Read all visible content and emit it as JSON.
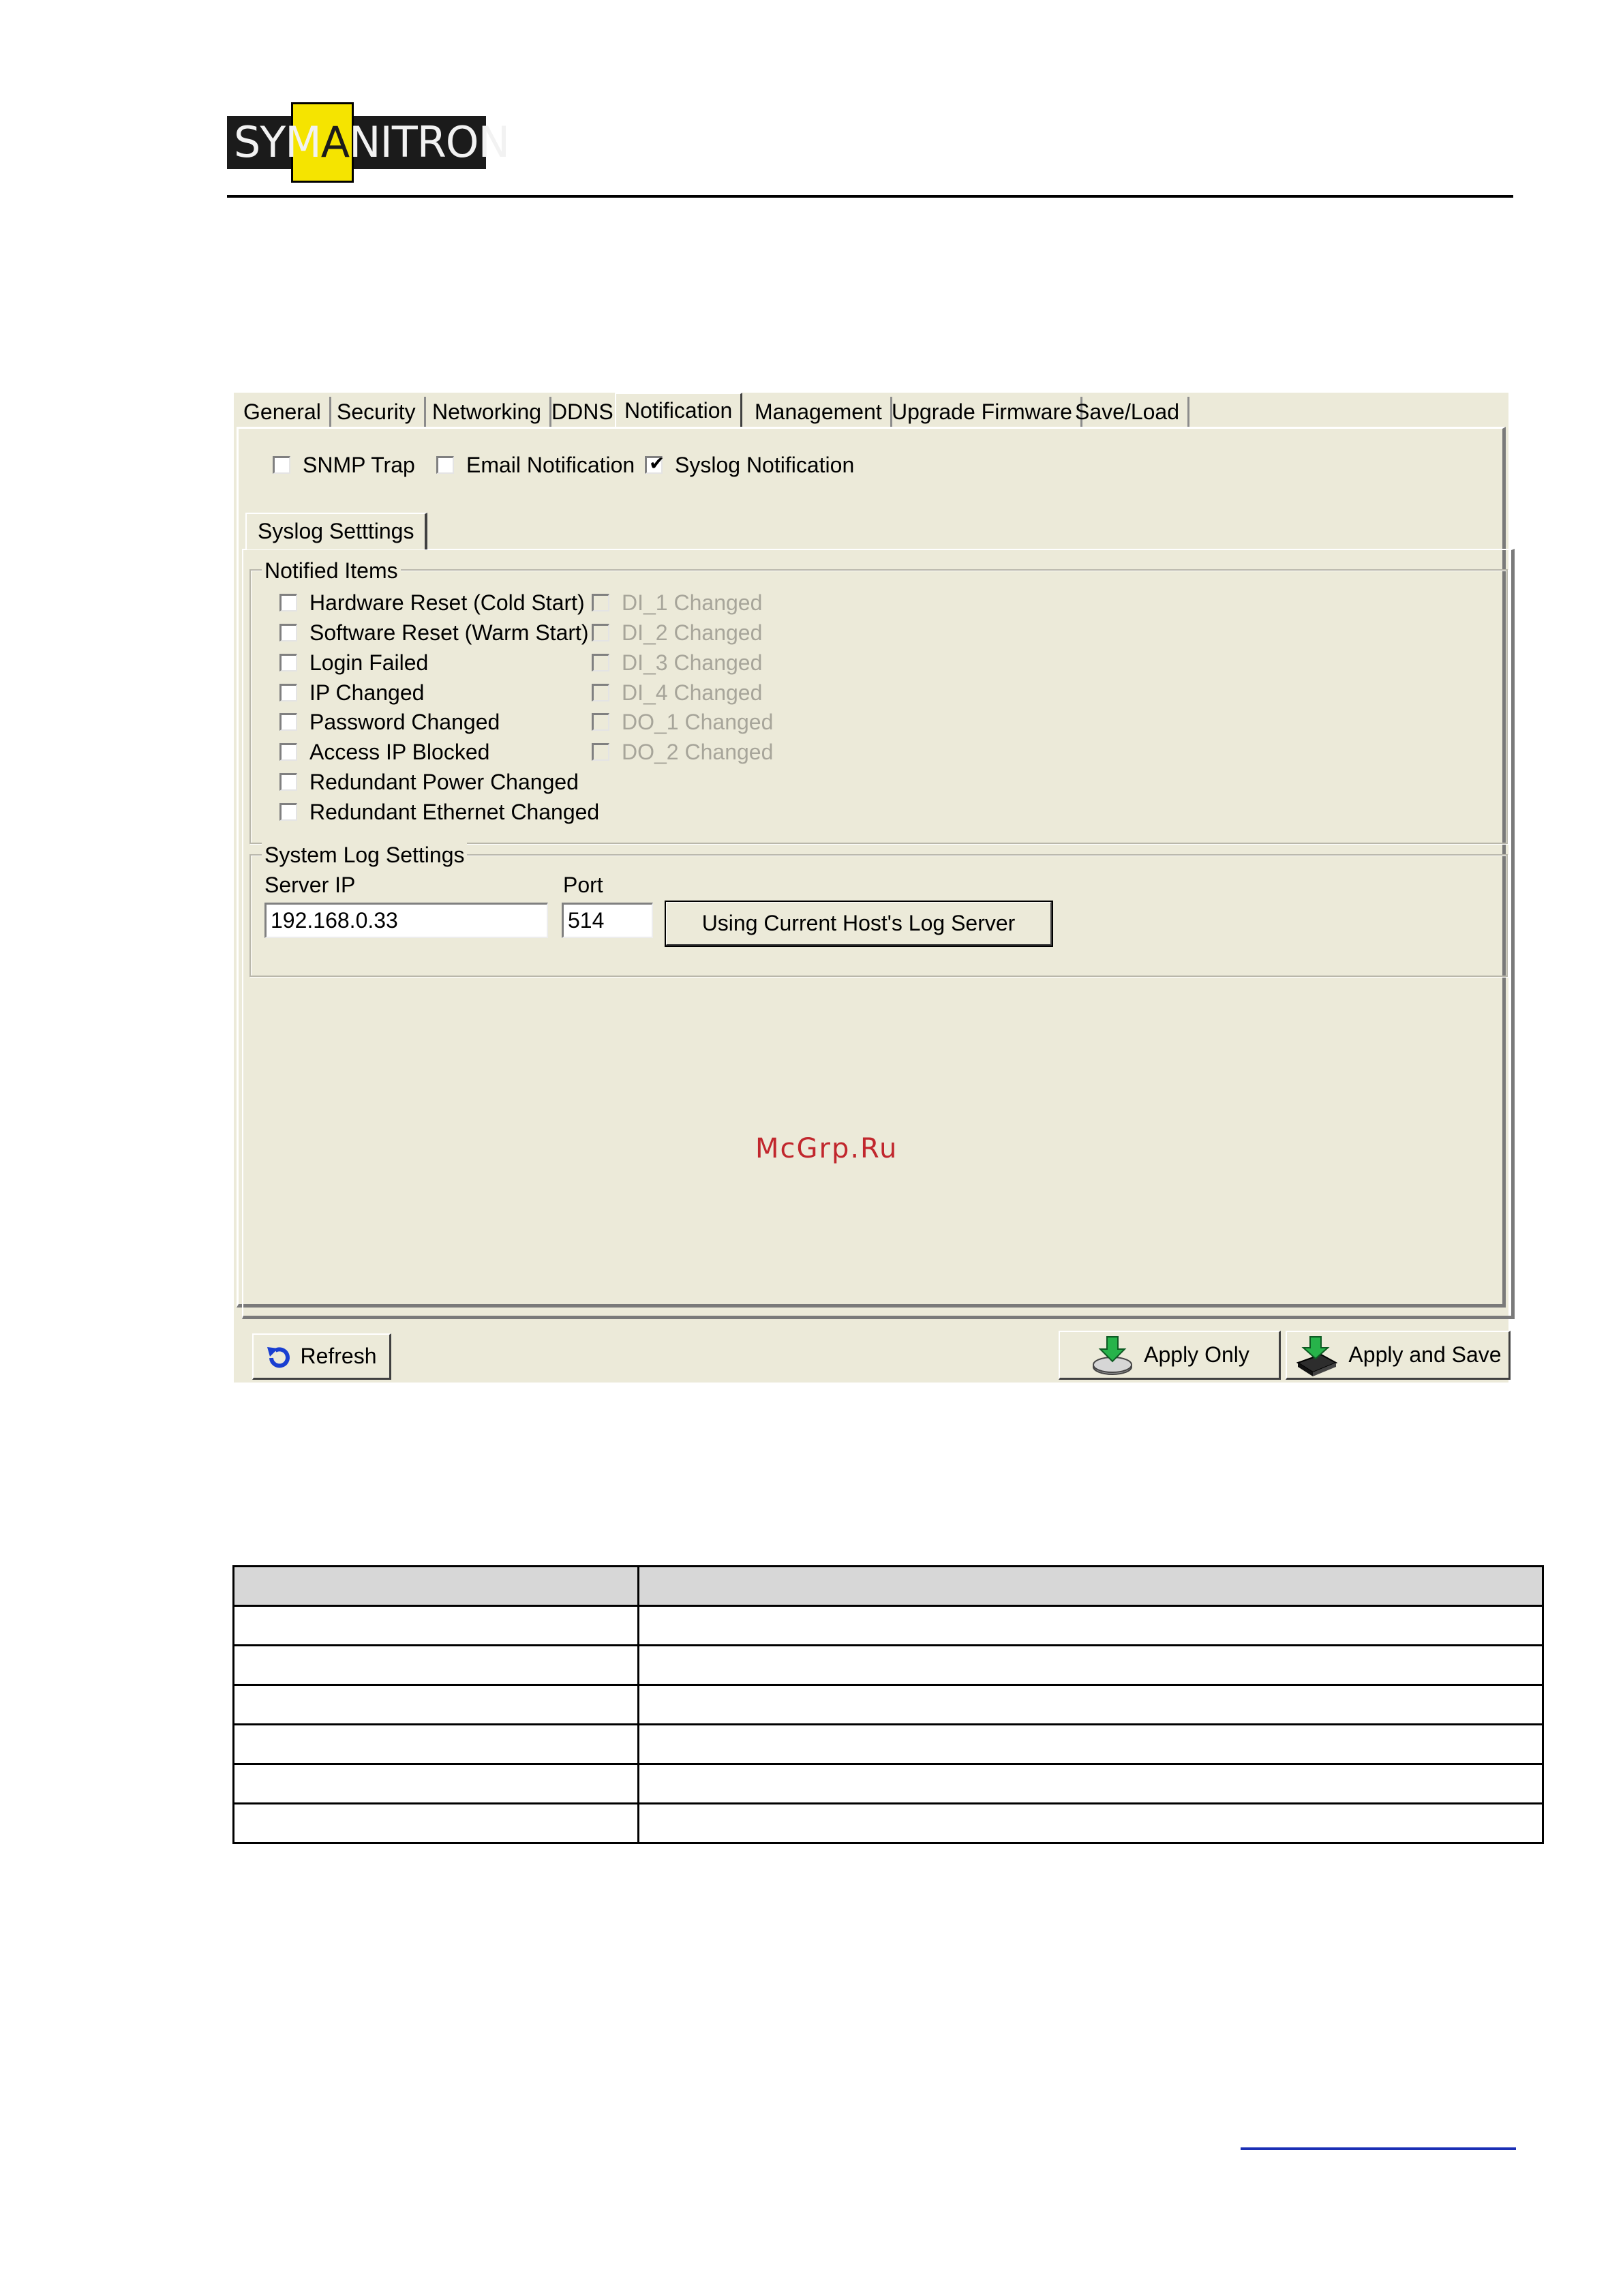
{
  "header": {
    "logo_text_a": "SYM",
    "logo_text_b": "A",
    "logo_text_c": "NITRON",
    "accent_color": "#f5e400"
  },
  "tabs": [
    {
      "label": "General",
      "active": false
    },
    {
      "label": "Security",
      "active": false
    },
    {
      "label": "Networking",
      "active": false
    },
    {
      "label": "DDNS",
      "active": false
    },
    {
      "label": "Notification",
      "active": true
    },
    {
      "label": "Management",
      "active": false
    },
    {
      "label": "Upgrade Firmware",
      "active": false
    },
    {
      "label": "Save/Load",
      "active": false
    }
  ],
  "notification_types": [
    {
      "label": "SNMP Trap",
      "checked": false
    },
    {
      "label": "Email Notification",
      "checked": false
    },
    {
      "label": "Syslog Notification",
      "checked": true
    }
  ],
  "syslog": {
    "subtab_label": "Syslog Setttings",
    "notified_items": {
      "legend": "Notified Items",
      "left": [
        {
          "label": "Hardware Reset (Cold Start)",
          "checked": false
        },
        {
          "label": "Software Reset (Warm Start)",
          "checked": false
        },
        {
          "label": "Login Failed",
          "checked": false
        },
        {
          "label": "IP Changed",
          "checked": false
        },
        {
          "label": "Password Changed",
          "checked": false
        },
        {
          "label": "Access IP Blocked",
          "checked": false
        },
        {
          "label": "Redundant Power Changed",
          "checked": false
        },
        {
          "label": "Redundant Ethernet Changed",
          "checked": false
        }
      ],
      "right": [
        {
          "label": "DI_1 Changed",
          "checked": false,
          "disabled": true
        },
        {
          "label": "DI_2 Changed",
          "checked": false,
          "disabled": true
        },
        {
          "label": "DI_3 Changed",
          "checked": false,
          "disabled": true
        },
        {
          "label": "DI_4 Changed",
          "checked": false,
          "disabled": true
        },
        {
          "label": "DO_1 Changed",
          "checked": false,
          "disabled": true
        },
        {
          "label": "DO_2 Changed",
          "checked": false,
          "disabled": true
        }
      ]
    },
    "system_log": {
      "legend": "System Log Settings",
      "server_ip_label": "Server IP",
      "server_ip_value": "192.168.0.33",
      "port_label": "Port",
      "port_value": "514",
      "host_button": "Using Current Host's Log Server"
    }
  },
  "watermark": "McGrp.Ru",
  "footer_buttons": {
    "refresh": "Refresh",
    "apply_only": "Apply Only",
    "apply_save": "Apply and Save"
  }
}
